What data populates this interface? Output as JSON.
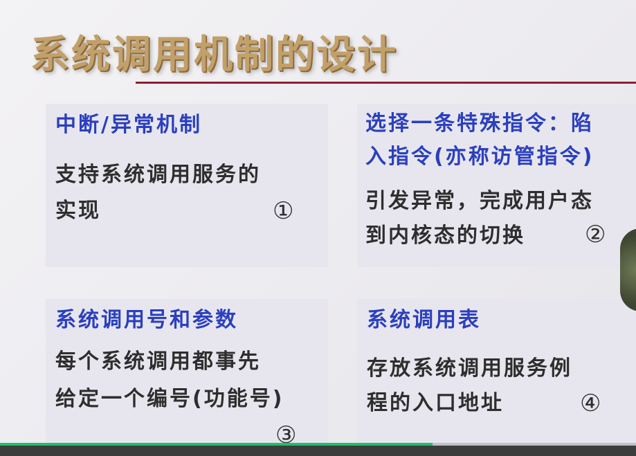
{
  "slide": {
    "title": "系统调用机制的设计",
    "panels": [
      {
        "heading_lines": [
          "中断/异常机制"
        ],
        "body_lines": [
          "支持系统调用服务的",
          "实现"
        ],
        "mark": "①"
      },
      {
        "heading_lines": [
          "选择一条特殊指令：陷",
          "入指令(亦称访管指令)"
        ],
        "body_lines": [
          "引发异常，完成用户态",
          "到内核态的切换"
        ],
        "mark": "②"
      },
      {
        "heading_lines": [
          "系统调用号和参数"
        ],
        "body_lines": [
          "每个系统调用都事先",
          "给定一个编号(功能号)"
        ],
        "mark": "③"
      },
      {
        "heading_lines": [
          "系统调用表"
        ],
        "body_lines": [
          "存放系统调用服务例",
          "程的入口地址"
        ],
        "mark": "④"
      }
    ],
    "colors": {
      "heading": "#2b3fbe",
      "body": "#2e2e2e",
      "title": "#c2a06a",
      "rule": "#8e1e32",
      "progress": "#1fbf6a"
    }
  },
  "player": {
    "progress_fraction": 0.68
  }
}
